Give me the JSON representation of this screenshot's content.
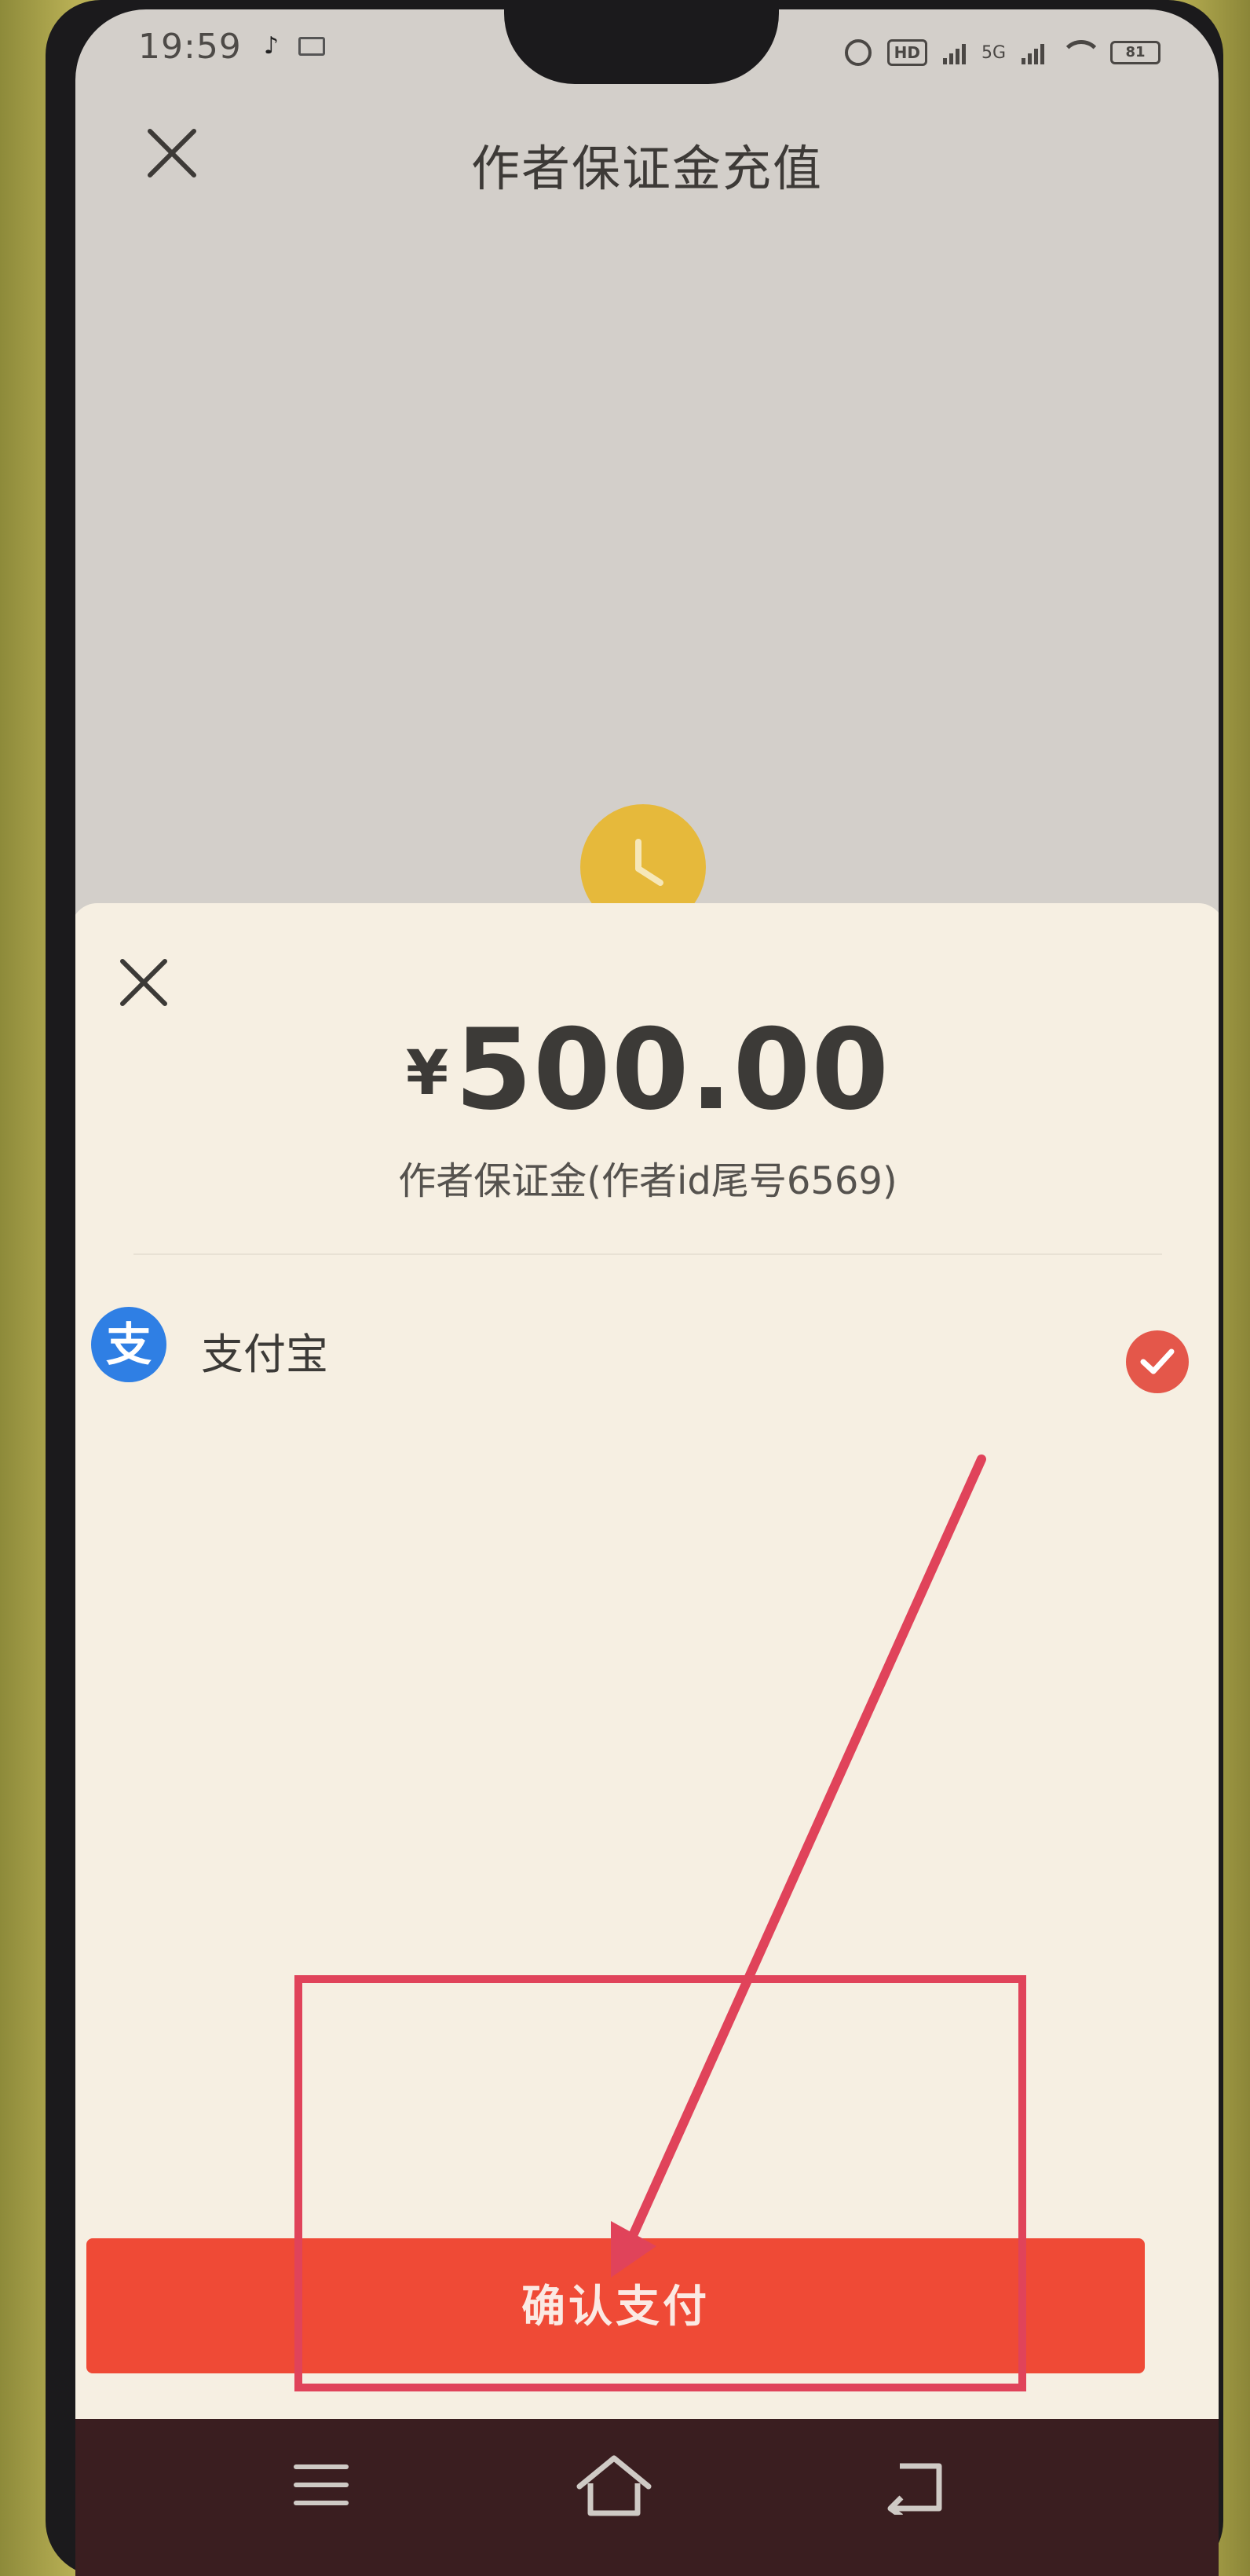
{
  "status_bar": {
    "time": "19:59",
    "hd_label": "HD",
    "network_label": "5G",
    "battery": "81"
  },
  "page": {
    "title": "作者保证金充值"
  },
  "sheet": {
    "currency": "¥",
    "amount": "500.00",
    "description": "作者保证金(作者id尾号6569)",
    "payment_method": {
      "icon_text": "支",
      "label": "支付宝",
      "selected": true
    },
    "confirm_label": "确认支付"
  },
  "colors": {
    "accent_red": "#ef4a36",
    "alipay_blue": "#2f7fe4",
    "check_red": "#e4574a",
    "annotation_red": "#e0435a"
  },
  "icons": [
    "close-icon",
    "clock-icon",
    "alipay-icon",
    "check-icon",
    "menu-icon",
    "home-icon",
    "back-icon",
    "alarm-icon",
    "wifi-icon",
    "battery-icon",
    "signal-icon"
  ]
}
